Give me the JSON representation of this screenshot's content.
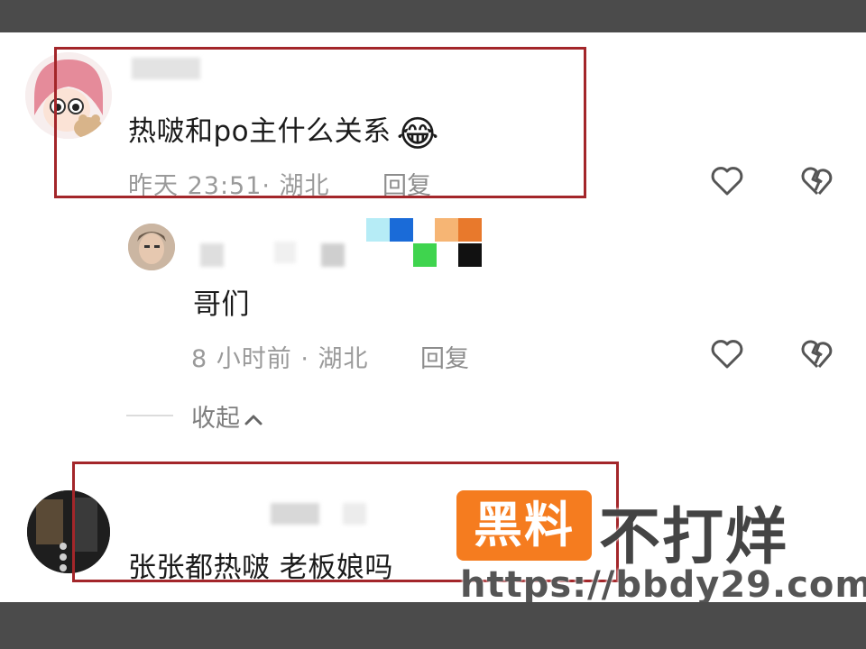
{
  "comments": [
    {
      "text": "热啵和po主什么关系",
      "emoji": "😂",
      "time": "昨天 23:51· 湖北",
      "reply_label": "回复"
    },
    {
      "text": "哥们",
      "time": "8 小时前 · 湖北",
      "reply_label": "回复"
    },
    {
      "text": "张张都热啵 老板娘吗"
    }
  ],
  "collapse_label": "收起",
  "watermark": {
    "badge": "黑料",
    "title": "不打烊",
    "url": "https://bbdy29.com"
  },
  "colors": {
    "highlight_box": "#a3262a",
    "watermark_badge": "#f57c1f"
  },
  "icons": [
    "heart-icon",
    "broken-heart-icon",
    "chevron-up-icon"
  ]
}
